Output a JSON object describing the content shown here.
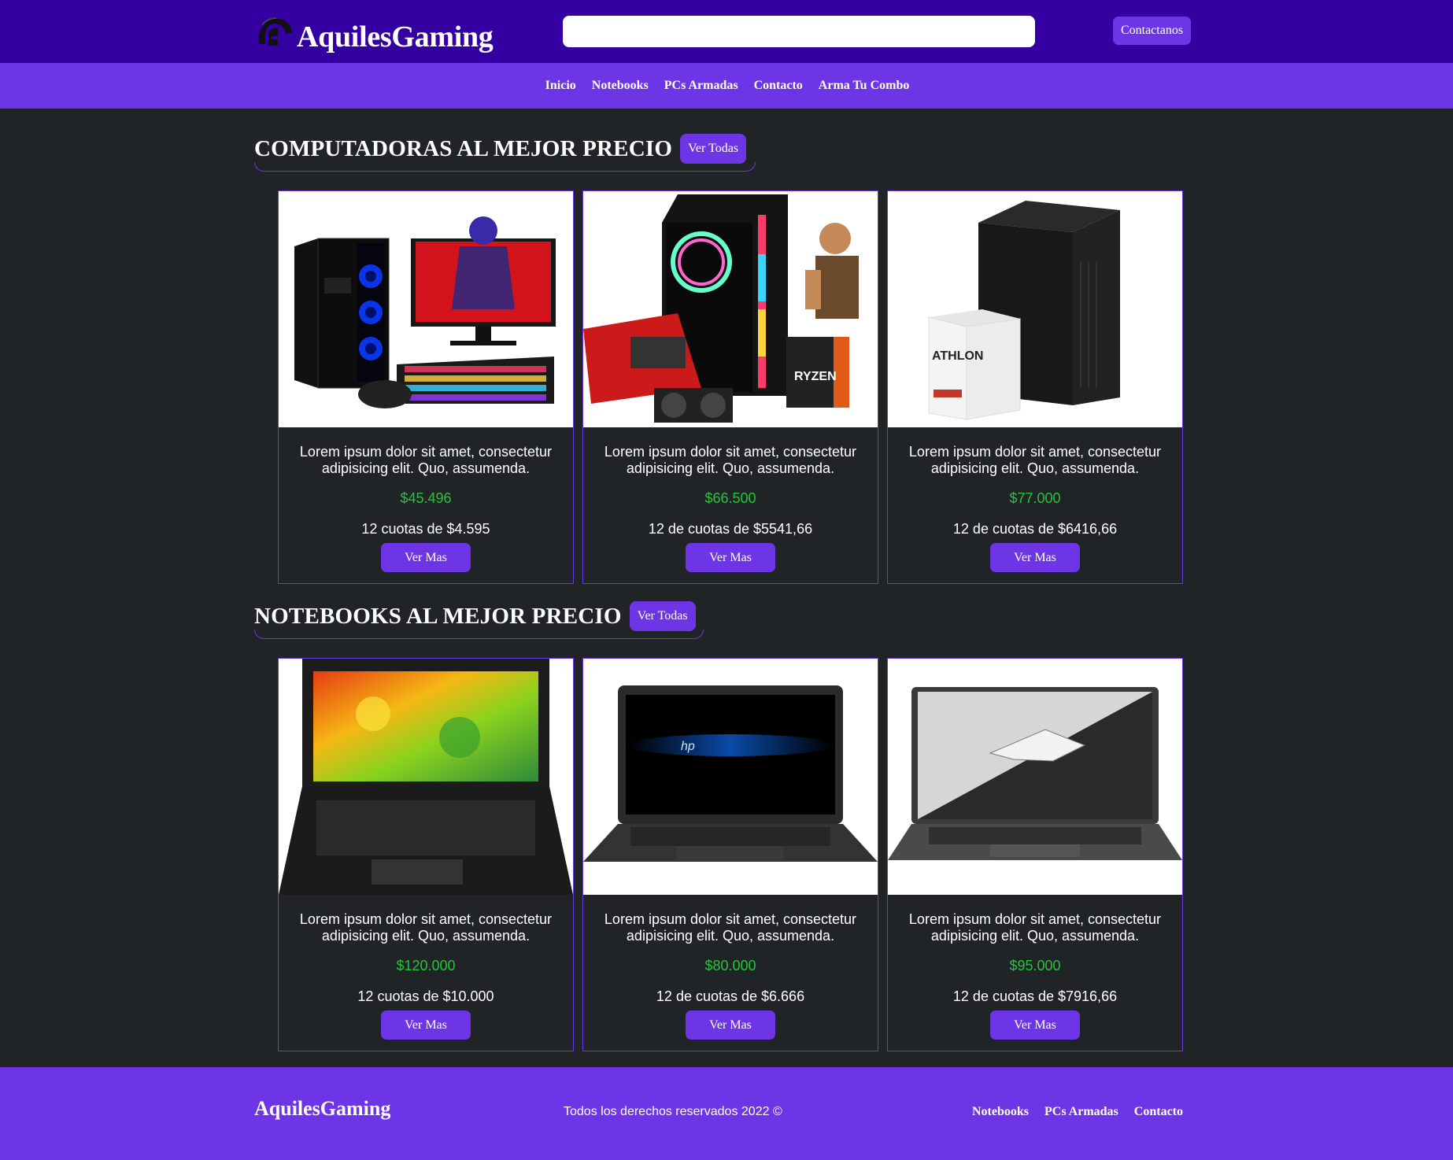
{
  "header": {
    "brand": "AquilesGaming",
    "search_placeholder": "",
    "search_value": "",
    "contact_button": "Contactanos"
  },
  "nav": {
    "items": [
      {
        "label": "Inicio"
      },
      {
        "label": "Notebooks"
      },
      {
        "label": "PCs Armadas"
      },
      {
        "label": "Contacto"
      },
      {
        "label": "Arma Tu Combo"
      }
    ]
  },
  "sections": [
    {
      "title": "COMPUTADORAS AL MEJOR PRECIO",
      "see_all": "Ver Todas",
      "products": [
        {
          "image": "gaming-pc-bundle-image",
          "description": "Lorem ipsum dolor sit amet, consectetur adipisicing elit. Quo, assumenda.",
          "price": "$45.496",
          "installments": "12 cuotas de $4.595",
          "button": "Ver Mas"
        },
        {
          "image": "ryzen-radeon-pc-image",
          "description": "Lorem ipsum dolor sit amet, consectetur adipisicing elit. Quo, assumenda.",
          "price": "$66.500",
          "installments": "12 de cuotas de $5541,66",
          "button": "Ver Mas"
        },
        {
          "image": "athlon-office-pc-image",
          "description": "Lorem ipsum dolor sit amet, consectetur adipisicing elit. Quo, assumenda.",
          "price": "$77.000",
          "installments": "12 de cuotas de $6416,66",
          "button": "Ver Mas"
        }
      ]
    },
    {
      "title": "NOTEBOOKS AL MEJOR PRECIO",
      "see_all": "Ver Todas",
      "products": [
        {
          "image": "lenovo-notebook-image",
          "description": "Lorem ipsum dolor sit amet, consectetur adipisicing elit. Quo, assumenda.",
          "price": "$120.000",
          "installments": "12 cuotas de $10.000",
          "button": "Ver Mas"
        },
        {
          "image": "hp-notebook-image",
          "description": "Lorem ipsum dolor sit amet, consectetur adipisicing elit. Quo, assumenda.",
          "price": "$80.000",
          "installments": "12 de cuotas de $6.666",
          "button": "Ver Mas"
        },
        {
          "image": "rog-notebook-image",
          "description": "Lorem ipsum dolor sit amet, consectetur adipisicing elit. Quo, assumenda.",
          "price": "$95.000",
          "installments": "12 de cuotas de $7916,66",
          "button": "Ver Mas"
        }
      ]
    }
  ],
  "footer": {
    "brand": "AquilesGaming",
    "copyright": "Todos los derechos reservados 2022 ©",
    "links": [
      {
        "label": "Notebooks"
      },
      {
        "label": "PCs Armadas"
      },
      {
        "label": "Contacto"
      }
    ]
  },
  "colors": {
    "header_bg": "#3400a2",
    "accent": "#6d35e6",
    "page_bg": "#202426",
    "price": "#23c53a"
  }
}
